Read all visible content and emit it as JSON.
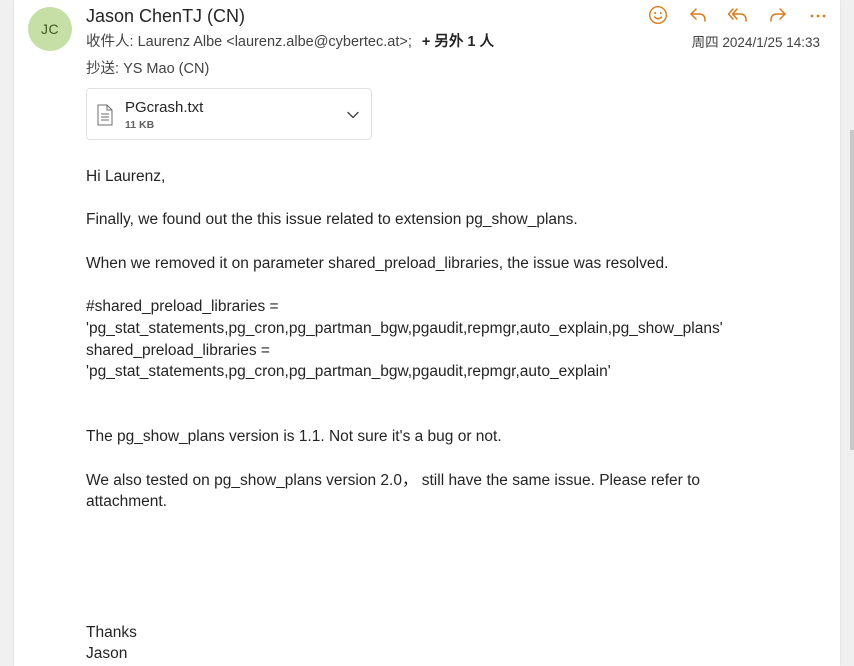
{
  "sender": {
    "initials": "JC",
    "name": "Jason ChenTJ (CN)",
    "avatar_color": "#c6dfa6"
  },
  "recipients": {
    "to_label": "收件人:",
    "to_value": "Laurenz Albe <laurenz.albe@cybertec.at>;",
    "more": "+ 另外 1 人",
    "cc_label": "抄送:",
    "cc_value": "YS Mao (CN)"
  },
  "datetime": "周四 2024/1/25 14:33",
  "actions": {
    "icons": [
      "emoji-icon",
      "reply-icon",
      "reply-all-icon",
      "forward-icon",
      "more-icon"
    ],
    "accent": "#d87b1c"
  },
  "attachment": {
    "name": "PGcrash.txt",
    "size": "11 KB"
  },
  "body": {
    "greeting": "Hi Laurenz,",
    "p1": "Finally, we found out the this issue related to extension  pg_show_plans.",
    "p2": "When we removed it on parameter shared_preload_libraries, the issue was resolved.",
    "code1a": "#shared_preload_libraries =",
    "code1b": "'pg_stat_statements,pg_cron,pg_partman_bgw,pgaudit,repmgr,auto_explain,pg_show_plans'",
    "code2a": "shared_preload_libraries =",
    "code2b": "'pg_stat_statements,pg_cron,pg_partman_bgw,pgaudit,repmgr,auto_explain'",
    "p3": "The pg_show_plans version is 1.1.  Not sure it's a bug or not.",
    "p4a": "We also tested on pg_show_plans version 2.0，  still have the same issue.  Please refer to",
    "p4b": "attachment.",
    "thanks": "Thanks",
    "signature": "Jason"
  }
}
